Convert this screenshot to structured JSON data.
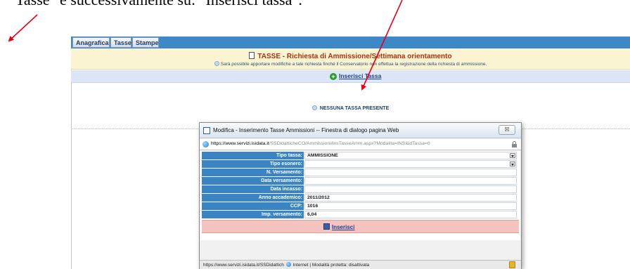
{
  "caption": "Tasse\" e successivamente su: \"Inserisci tassa\".",
  "tabs": [
    {
      "label": "Anagrafica"
    },
    {
      "label": "Tasse"
    },
    {
      "label": "Stampe"
    }
  ],
  "banner": {
    "title": "TASSE - Richiesta di Ammissione/Settimana orientamento",
    "note": "Sarà possibile apportare modifiche a tale richiesta finché il Conservatorio non effettua la registrazione della richiesta di ammissione."
  },
  "add_tax_label": "Inserisci Tassa",
  "empty_message": "NESSUNA TASSA PRESENTE",
  "dialog": {
    "title": "Modifica - Inserimento Tasse Ammissioni -- Finestra di dialogo pagina Web",
    "close_label": "☒",
    "url_host": "https://www.servizi.isidata.it",
    "url_rest": "/SSDidatticheCO/Ammissioni/InsTasseAmm.aspx?Modalita=INS&idTassa=0",
    "fields": [
      {
        "label": "Tipo tassa:",
        "value": "AMMISSIONE",
        "dropdown": true
      },
      {
        "label": "Tipo esonero:",
        "value": "",
        "dropdown": true
      },
      {
        "label": "N. Versamento:",
        "value": ""
      },
      {
        "label": "Data versamento:",
        "value": ""
      },
      {
        "label": "Data incasso:",
        "value": ""
      },
      {
        "label": "Anno accademico:",
        "value": "2011/2012"
      },
      {
        "label": "CCP:",
        "value": "1016"
      },
      {
        "label": "Imp. versamento:",
        "value": "6,04"
      }
    ],
    "submit_label": "Inserisci",
    "status_url": "https://www.servizi.isidata.it/SSDidattich",
    "status_zone": "Internet | Modalità protetta: disattivata"
  },
  "colors": {
    "tabbar": "#3f88c7",
    "banner": "#fbf4d2",
    "label_bg": "#3b84c4",
    "submit_bg": "#f4c3bf",
    "arrow": "#e8001b"
  }
}
